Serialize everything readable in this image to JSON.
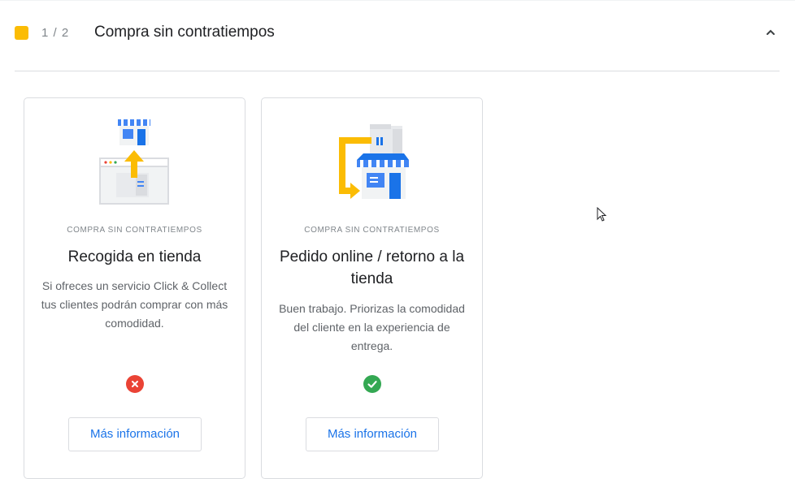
{
  "section": {
    "counter": "1 / 2",
    "title": "Compra sin contratiempos",
    "accent_color": "#fbbc04",
    "collapse_icon": "chevron-up-icon"
  },
  "cards": [
    {
      "illustration": "store-pickup-illustration",
      "eyebrow": "COMPRA SIN CONTRATIEMPOS",
      "title": "Recogida en tienda",
      "description": "Si ofreces un servicio Click & Collect tus clientes podrán comprar con más comodidad.",
      "status_icon": "error-x-icon",
      "status_color": "#ea4335",
      "button_label": "Más información"
    },
    {
      "illustration": "order-online-return-illustration",
      "eyebrow": "COMPRA SIN CONTRATIEMPOS",
      "title": "Pedido online / retorno a la tienda",
      "description": "Buen trabajo. Priorizas la comodidad del cliente en la experiencia de entrega.",
      "status_icon": "check-icon",
      "status_color": "#34a853",
      "button_label": "Más información"
    }
  ]
}
